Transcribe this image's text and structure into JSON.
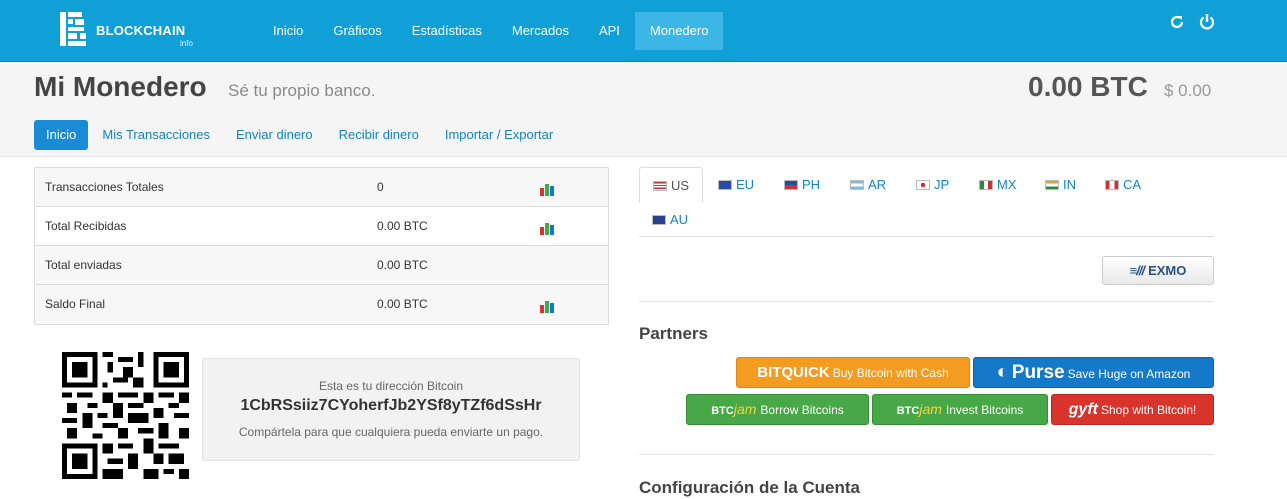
{
  "brand": {
    "name": "BLOCKCHAIN",
    "sub": "info"
  },
  "nav": {
    "items": [
      {
        "label": "Inicio"
      },
      {
        "label": "Gráficos"
      },
      {
        "label": "Estadísticas"
      },
      {
        "label": "Mercados"
      },
      {
        "label": "API"
      },
      {
        "label": "Monedero",
        "active": true
      }
    ],
    "icons": [
      "refresh-icon",
      "power-icon"
    ]
  },
  "header": {
    "title": "Mi Monedero",
    "subtitle": "Sé tu propio banco.",
    "balance": "0.00 BTC",
    "balance_usd": "$ 0.00"
  },
  "tabs": [
    {
      "label": "Inicio",
      "active": true
    },
    {
      "label": "Mis Transacciones"
    },
    {
      "label": "Enviar dinero"
    },
    {
      "label": "Recibir dinero"
    },
    {
      "label": "Importar / Exportar"
    }
  ],
  "stats": [
    {
      "label": "Transacciones Totales",
      "value": "0",
      "chart": true
    },
    {
      "label": "Total Recibidas",
      "value": "0.00 BTC",
      "chart": true
    },
    {
      "label": "Total enviadas",
      "value": "0.00 BTC",
      "chart": false
    },
    {
      "label": "Saldo Final",
      "value": "0.00 BTC",
      "chart": true
    }
  ],
  "address": {
    "intro": "Esta es tu dirección Bitcoin",
    "value": "1CbRSsiiz7CYoherfJb2YSf8yTZf6dSsHr",
    "share": "Compártela para que cualquiera pueda enviarte un pago."
  },
  "currencies": [
    {
      "code": "US",
      "active": true
    },
    {
      "code": "EU"
    },
    {
      "code": "PH"
    },
    {
      "code": "AR"
    },
    {
      "code": "JP"
    },
    {
      "code": "MX"
    },
    {
      "code": "IN"
    },
    {
      "code": "CA"
    },
    {
      "code": "AU"
    }
  ],
  "exchange_button": "EXMO",
  "partners": {
    "heading": "Partners",
    "buttons": [
      {
        "brand": "BITQUICK",
        "label": "Buy Bitcoin with Cash",
        "color": "#f39c1f"
      },
      {
        "brand": "Purse",
        "label": "Save Huge on Amazon",
        "color": "#1579c9"
      },
      {
        "brand": "BTC",
        "brand2": "jam",
        "label": "Borrow Bitcoins",
        "color": "#47a847"
      },
      {
        "brand": "BTC",
        "brand2": "jam",
        "label": "Invest Bitcoins",
        "color": "#47a847"
      },
      {
        "brand": "gyft",
        "label": "Shop with Bitcoin!",
        "color": "#d9342b"
      }
    ]
  },
  "config_heading": "Configuración de la Cuenta"
}
